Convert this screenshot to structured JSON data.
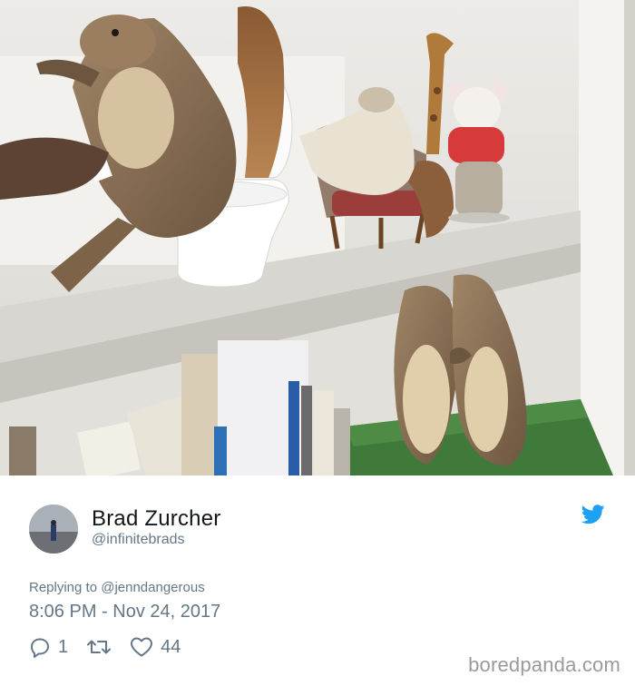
{
  "photo": {
    "description_icon": "shelf-photo"
  },
  "tweet": {
    "author_name": "Brad Zurcher",
    "author_handle": "@infinitebrads",
    "replying_to": "Replying to @jenndangerous",
    "timestamp": "8:06 PM - Nov 24, 2017",
    "reply_count": "1",
    "like_count": "44",
    "brand_color": "#1da1f2",
    "icons": {
      "platform": "twitter-bird-icon",
      "reply": "reply-icon",
      "retweet": "retweet-icon",
      "like": "heart-icon"
    }
  },
  "watermark": "boredpanda.com"
}
